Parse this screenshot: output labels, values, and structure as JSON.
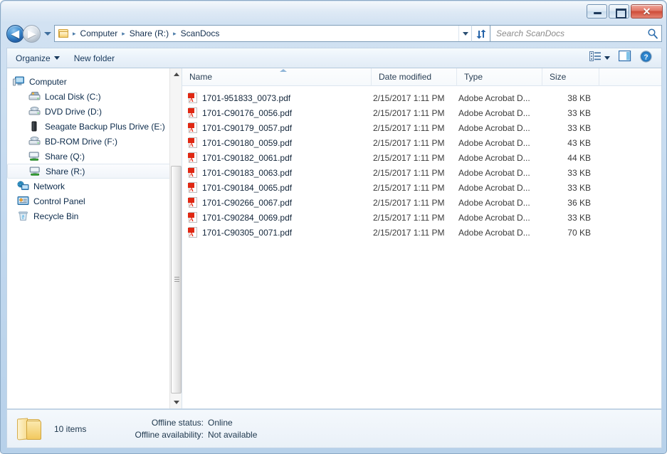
{
  "window": {
    "controls": {
      "minimize": "minimize-button",
      "maximize": "maximize-button",
      "close_glyph": "✕"
    }
  },
  "address_bar": {
    "back_glyph": "◀",
    "forward_glyph": "▶",
    "breadcrumbs": [
      "Computer",
      "Share (R:)",
      "ScanDocs"
    ],
    "separator": "▸"
  },
  "search": {
    "placeholder": "Search ScanDocs",
    "value": ""
  },
  "toolbar": {
    "organize_label": "Organize",
    "new_folder_label": "New folder"
  },
  "sidebar": {
    "items": [
      {
        "label": "Computer",
        "icon": "computer-icon",
        "level": 0,
        "selected": false
      },
      {
        "label": "Local Disk (C:)",
        "icon": "hard-drive-icon",
        "level": 1,
        "selected": false
      },
      {
        "label": "DVD Drive (D:)",
        "icon": "optical-drive-icon",
        "level": 1,
        "selected": false
      },
      {
        "label": "Seagate Backup Plus Drive (E:)",
        "icon": "external-drive-icon",
        "level": 1,
        "selected": false
      },
      {
        "label": "BD-ROM Drive (F:)",
        "icon": "optical-drive-icon",
        "level": 1,
        "selected": false
      },
      {
        "label": "Share (Q:)",
        "icon": "network-drive-icon",
        "level": 1,
        "selected": false
      },
      {
        "label": "Share (R:)",
        "icon": "network-drive-icon",
        "level": 1,
        "selected": true
      },
      {
        "label": "Network",
        "icon": "network-icon",
        "level": 0,
        "selected": false
      },
      {
        "label": "Control Panel",
        "icon": "control-panel-icon",
        "level": 0,
        "selected": false
      },
      {
        "label": "Recycle Bin",
        "icon": "recycle-bin-icon",
        "level": 0,
        "selected": false
      }
    ]
  },
  "file_list": {
    "columns": [
      "Name",
      "Date modified",
      "Type",
      "Size"
    ],
    "sort_column": "Name",
    "sort_direction": "ascending",
    "rows": [
      {
        "name": "1701-951833_0073.pdf",
        "date": "2/15/2017 1:11 PM",
        "type": "Adobe Acrobat D...",
        "size": "38 KB"
      },
      {
        "name": "1701-C90176_0056.pdf",
        "date": "2/15/2017 1:11 PM",
        "type": "Adobe Acrobat D...",
        "size": "33 KB"
      },
      {
        "name": "1701-C90179_0057.pdf",
        "date": "2/15/2017 1:11 PM",
        "type": "Adobe Acrobat D...",
        "size": "33 KB"
      },
      {
        "name": "1701-C90180_0059.pdf",
        "date": "2/15/2017 1:11 PM",
        "type": "Adobe Acrobat D...",
        "size": "43 KB"
      },
      {
        "name": "1701-C90182_0061.pdf",
        "date": "2/15/2017 1:11 PM",
        "type": "Adobe Acrobat D...",
        "size": "44 KB"
      },
      {
        "name": "1701-C90183_0063.pdf",
        "date": "2/15/2017 1:11 PM",
        "type": "Adobe Acrobat D...",
        "size": "33 KB"
      },
      {
        "name": "1701-C90184_0065.pdf",
        "date": "2/15/2017 1:11 PM",
        "type": "Adobe Acrobat D...",
        "size": "33 KB"
      },
      {
        "name": "1701-C90266_0067.pdf",
        "date": "2/15/2017 1:11 PM",
        "type": "Adobe Acrobat D...",
        "size": "36 KB"
      },
      {
        "name": "1701-C90284_0069.pdf",
        "date": "2/15/2017 1:11 PM",
        "type": "Adobe Acrobat D...",
        "size": "33 KB"
      },
      {
        "name": "1701-C90305_0071.pdf",
        "date": "2/15/2017 1:11 PM",
        "type": "Adobe Acrobat D...",
        "size": "70 KB"
      }
    ]
  },
  "status_bar": {
    "item_count": "10 items",
    "offline_status_label": "Offline status:",
    "offline_status_value": "Online",
    "offline_availability_label": "Offline availability:",
    "offline_availability_value": "Not available"
  },
  "colors": {
    "frame": "#b7d1ea",
    "accent": "#1f5fa8",
    "pdf_red": "#e02712",
    "folder_yellow": "#f2c95f"
  }
}
